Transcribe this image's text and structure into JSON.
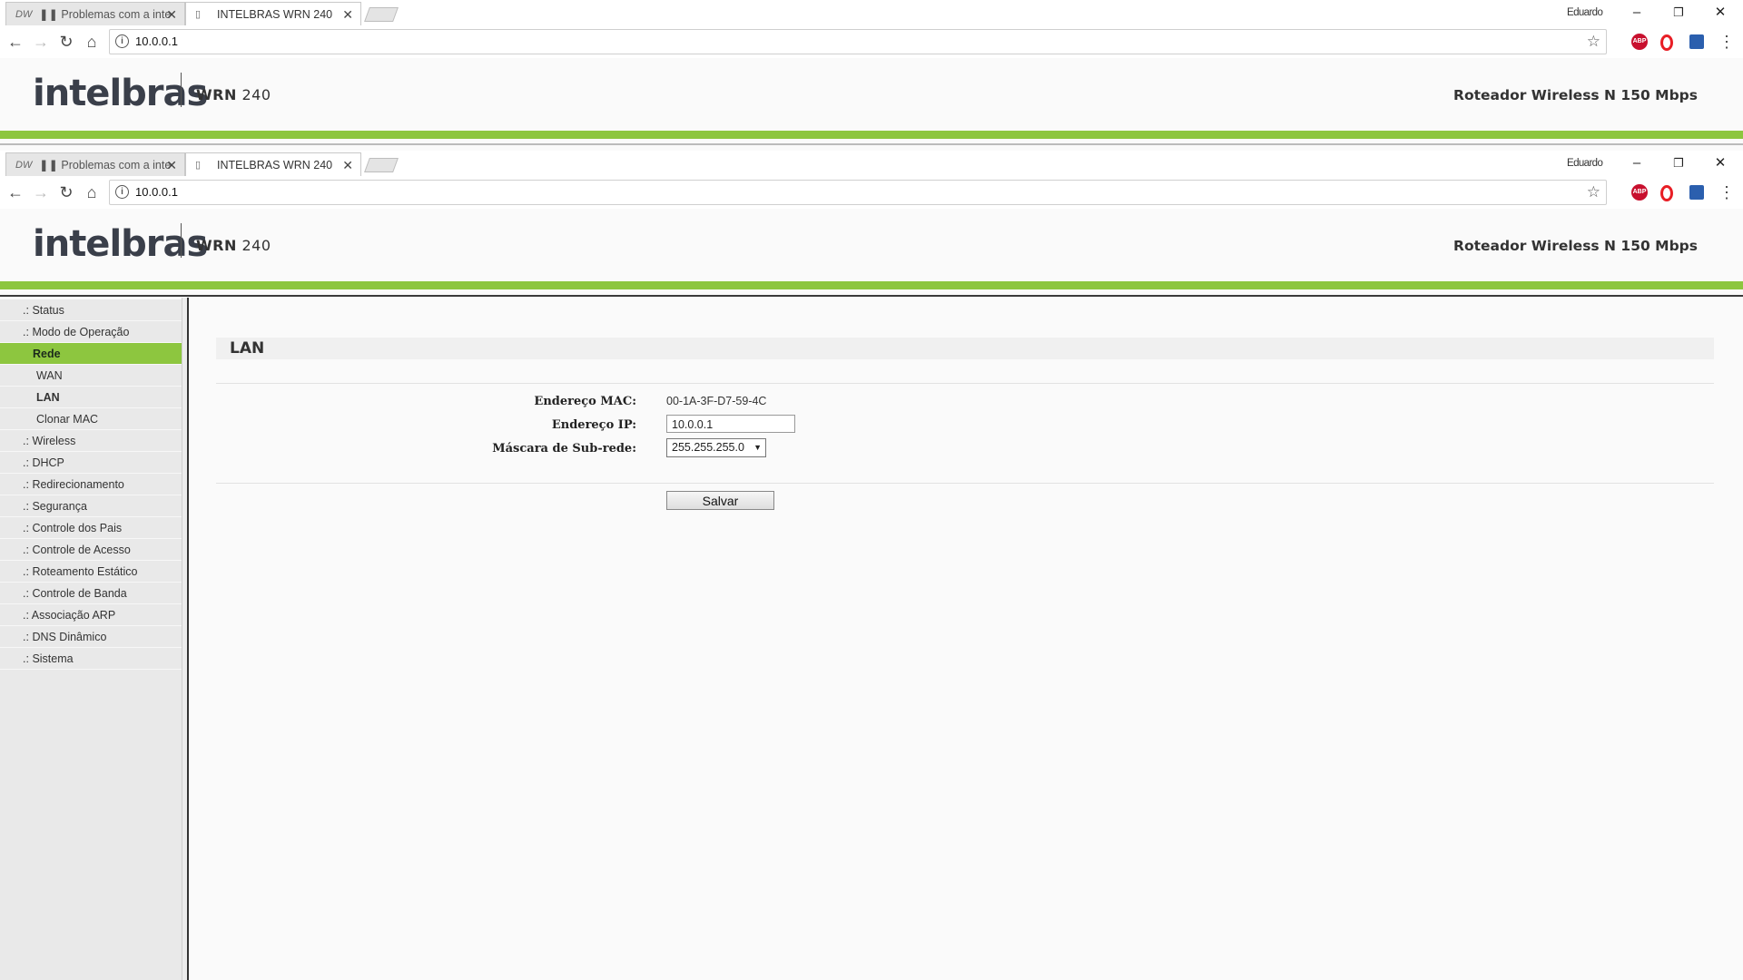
{
  "browser": {
    "tabs": [
      {
        "favicon": "DW",
        "title": "❚❚ Problemas com a inte",
        "active": false
      },
      {
        "favicon": "page-icon",
        "title": "INTELBRAS WRN 240",
        "active": true
      }
    ],
    "profile_name": "Eduardo",
    "url": "10.0.0.1"
  },
  "router": {
    "logo": "intelbras",
    "model_name": "WRN",
    "model_number": "240",
    "product": "Roteador Wireless N 150 Mbps"
  },
  "sidebar": {
    "items": [
      {
        "label": "Status",
        "prefix": ".:"
      },
      {
        "label": "Modo de Operação",
        "prefix": ".:"
      },
      {
        "label": "Rede",
        "prefix": "",
        "active": true
      },
      {
        "label": "WAN",
        "sub": true
      },
      {
        "label": "LAN",
        "sub": true,
        "current": true
      },
      {
        "label": "Clonar MAC",
        "sub": true
      },
      {
        "label": "Wireless",
        "prefix": ".:"
      },
      {
        "label": "DHCP",
        "prefix": ".:"
      },
      {
        "label": "Redirecionamento",
        "prefix": ".:"
      },
      {
        "label": "Segurança",
        "prefix": ".:"
      },
      {
        "label": "Controle dos Pais",
        "prefix": ".:"
      },
      {
        "label": "Controle de Acesso",
        "prefix": ".:"
      },
      {
        "label": "Roteamento Estático",
        "prefix": ".:"
      },
      {
        "label": "Controle de Banda",
        "prefix": ".:"
      },
      {
        "label": "Associação ARP",
        "prefix": ".:"
      },
      {
        "label": "DNS Dinâmico",
        "prefix": ".:"
      },
      {
        "label": "Sistema",
        "prefix": ".:"
      }
    ]
  },
  "content": {
    "title": "LAN",
    "mac_label": "Endereço MAC:",
    "mac_value": "00-1A-3F-D7-59-4C",
    "ip_label": "Endereço IP:",
    "ip_value": "10.0.0.1",
    "mask_label": "Máscara de Sub-rede:",
    "mask_value": "255.255.255.0",
    "save_label": "Salvar"
  },
  "colors": {
    "accent_green": "#8dc63f",
    "logo_dark": "#3a3f4a"
  }
}
